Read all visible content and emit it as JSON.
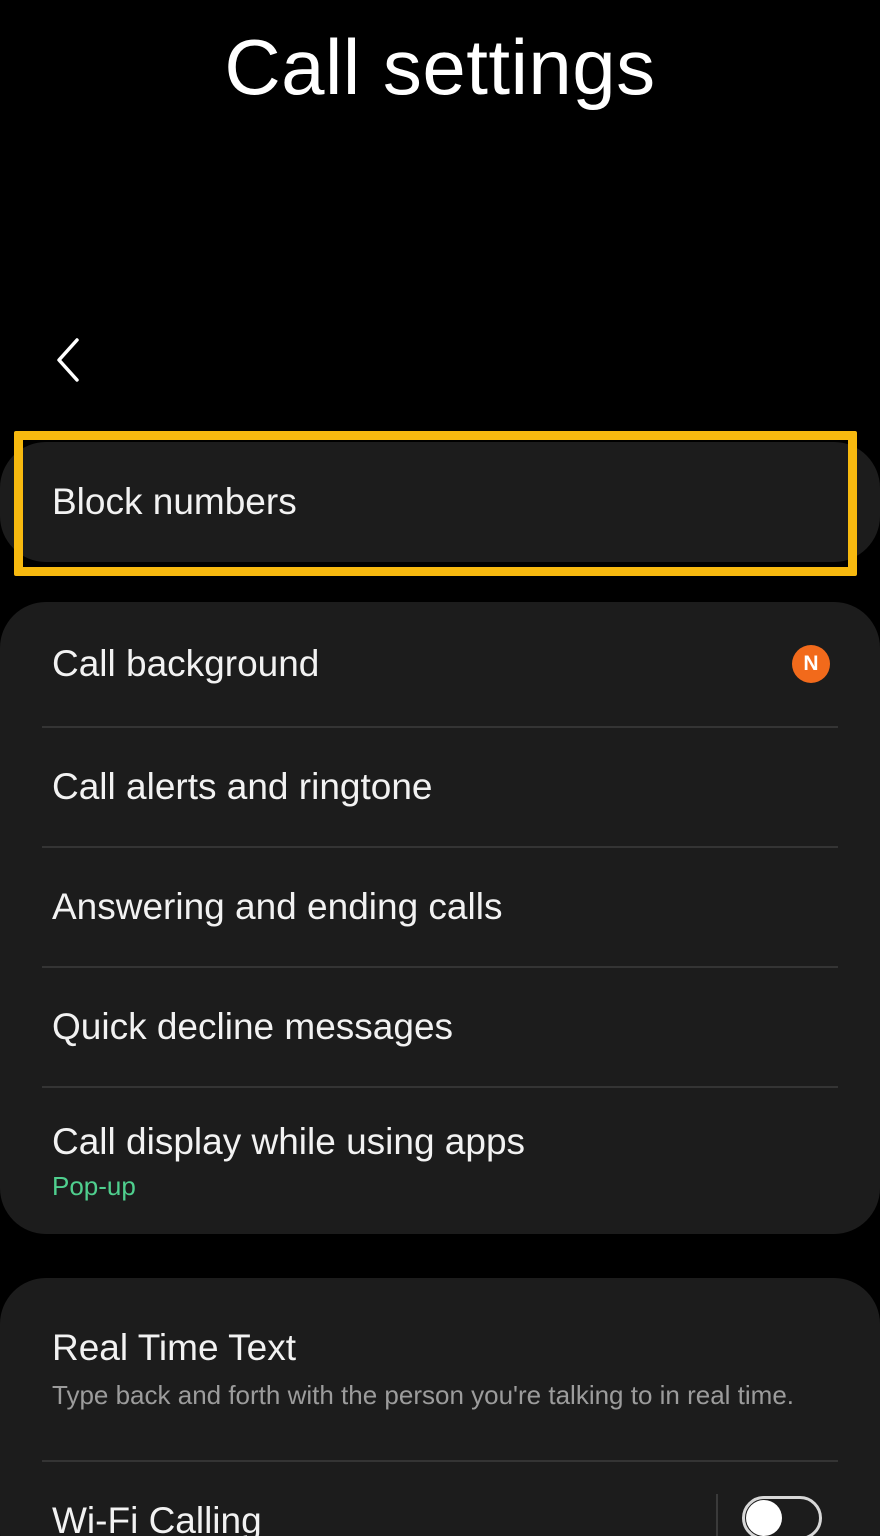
{
  "header": {
    "title": "Call settings",
    "back_icon": "chevron-left"
  },
  "block_numbers": {
    "label": "Block numbers",
    "highlight_color": "#f7b90f"
  },
  "group1": {
    "items": [
      {
        "label": "Call background",
        "badge": "N"
      },
      {
        "label": "Call alerts and ringtone"
      },
      {
        "label": "Answering and ending calls"
      },
      {
        "label": "Quick decline messages"
      },
      {
        "label": "Call display while using apps",
        "value": "Pop-up"
      }
    ]
  },
  "group2": {
    "real_time_text": {
      "label": "Real Time Text",
      "description": "Type back and forth with the person you're talking to in real time."
    },
    "wifi_calling": {
      "label": "Wi-Fi Calling",
      "toggle_on": false
    }
  },
  "colors": {
    "background": "#000000",
    "card": "#1c1c1c",
    "accent_green": "#4fcf8e",
    "badge_orange": "#f26a1b"
  }
}
